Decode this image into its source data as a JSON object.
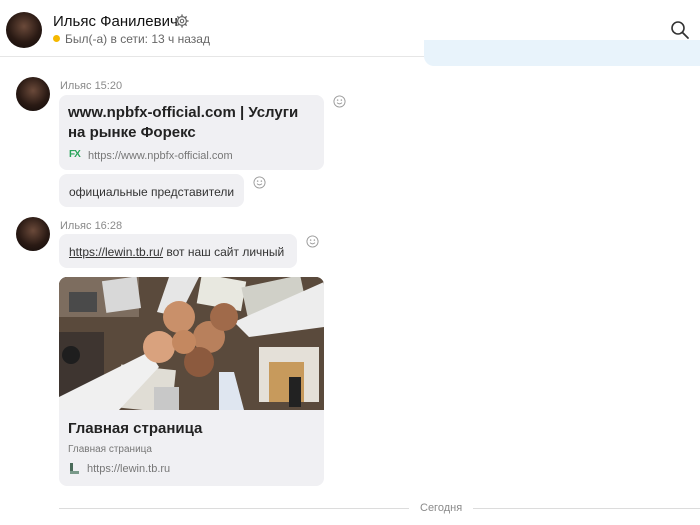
{
  "header": {
    "contact_name": "Ильяс Фанилевич",
    "status_text": "Был(-а) в сети: 13 ч назад",
    "status_color": "#f5b800",
    "icons": [
      "settings-gear-icon",
      "search-icon"
    ]
  },
  "messages": [
    {
      "sender_time": "Ильяс 15:20",
      "link_preview": {
        "title": "www.npbfx-official.com | Услуги на рынке Форекс",
        "title_line1": "www.npbfx-official.com | Услуги",
        "title_line2": "на рынке Форекс",
        "favicon_text": "FX",
        "url": "https://www.npbfx-official.com"
      },
      "text": "официальные представители"
    },
    {
      "sender_time": "Ильяс 16:28",
      "link": "https://lewin.tb.ru/",
      "text": " вот наш сайт личный",
      "link_preview": {
        "title": "Главная страница",
        "subtitle": "Главная страница",
        "url": "https://lewin.tb.ru"
      }
    }
  ],
  "date_separator": "Сегодня",
  "colors": {
    "bubble_bg": "#f0f0f3",
    "own_bubble_bg": "#e8f3fb",
    "favicon_green": "#29a35a"
  }
}
